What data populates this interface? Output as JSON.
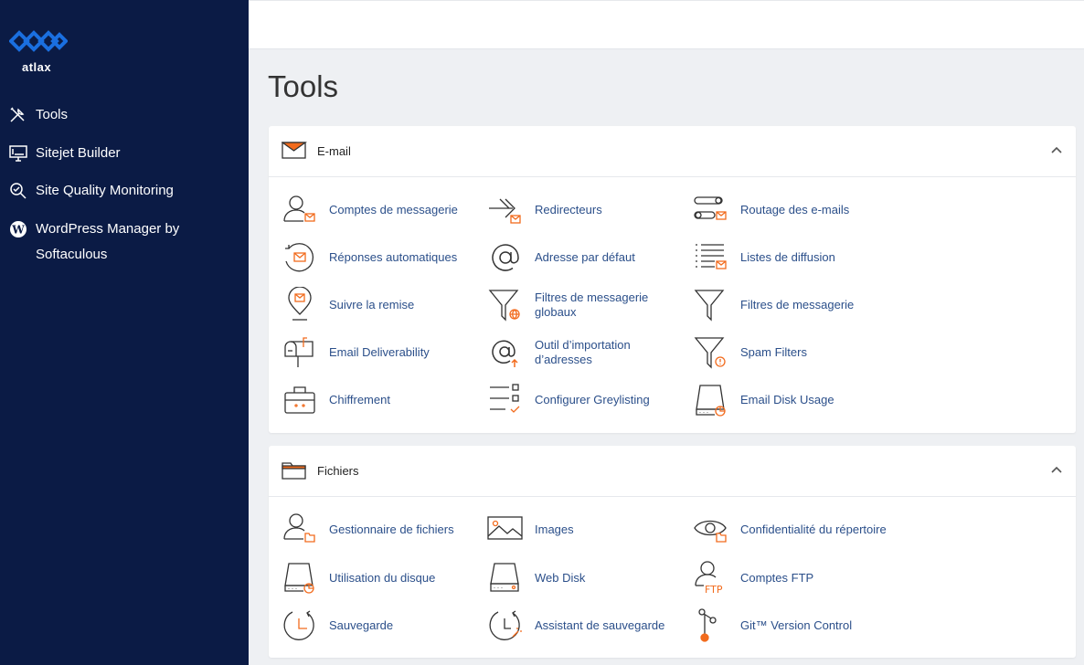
{
  "brand": {
    "name": "atlax",
    "accent": "#1a6fe0",
    "sidebar_bg": "#0b1b45",
    "icon_orange": "#f26b1d",
    "link_color": "#2b4f8a"
  },
  "sidebar": {
    "items": [
      {
        "label": "Tools",
        "icon": "tools-icon"
      },
      {
        "label": "Sitejet Builder",
        "icon": "monitor-icon"
      },
      {
        "label": "Site Quality Monitoring",
        "icon": "search-icon"
      },
      {
        "label": "WordPress Manager by Softaculous",
        "icon": "wordpress-icon"
      }
    ]
  },
  "page": {
    "title": "Tools"
  },
  "sections": {
    "email": {
      "title": "E-mail",
      "tools": [
        {
          "label": "Comptes de messagerie",
          "icon": "email-accounts-icon"
        },
        {
          "label": "Redirecteurs",
          "icon": "forwarders-icon"
        },
        {
          "label": "Routage des e-mails",
          "icon": "email-routing-icon"
        },
        {
          "label": "Réponses automatiques",
          "icon": "autoresponders-icon"
        },
        {
          "label": "Adresse par défaut",
          "icon": "default-address-icon"
        },
        {
          "label": "Listes de diffusion",
          "icon": "mailing-lists-icon"
        },
        {
          "label": "Suivre la remise",
          "icon": "track-delivery-icon"
        },
        {
          "label": "Filtres de messagerie globaux",
          "icon": "global-filters-icon"
        },
        {
          "label": "Filtres de messagerie",
          "icon": "email-filters-icon"
        },
        {
          "label": "Email Deliverability",
          "icon": "deliverability-icon"
        },
        {
          "label": "Outil d’importation d’adresses",
          "icon": "address-importer-icon"
        },
        {
          "label": "Spam Filters",
          "icon": "spam-filters-icon"
        },
        {
          "label": "Chiffrement",
          "icon": "encryption-icon"
        },
        {
          "label": "Configurer Greylisting",
          "icon": "greylisting-icon"
        },
        {
          "label": "Email Disk Usage",
          "icon": "email-disk-usage-icon"
        }
      ]
    },
    "files": {
      "title": "Fichiers",
      "tools": [
        {
          "label": "Gestionnaire de fichiers",
          "icon": "file-manager-icon"
        },
        {
          "label": "Images",
          "icon": "images-icon"
        },
        {
          "label": "Confidentialité du répertoire",
          "icon": "directory-privacy-icon"
        },
        {
          "label": "Utilisation du disque",
          "icon": "disk-usage-icon"
        },
        {
          "label": "Web Disk",
          "icon": "web-disk-icon"
        },
        {
          "label": "Comptes FTP",
          "icon": "ftp-accounts-icon"
        },
        {
          "label": "Sauvegarde",
          "icon": "backup-icon"
        },
        {
          "label": "Assistant de sauvegarde",
          "icon": "backup-wizard-icon"
        },
        {
          "label": "Git™ Version Control",
          "icon": "git-icon"
        }
      ]
    }
  }
}
